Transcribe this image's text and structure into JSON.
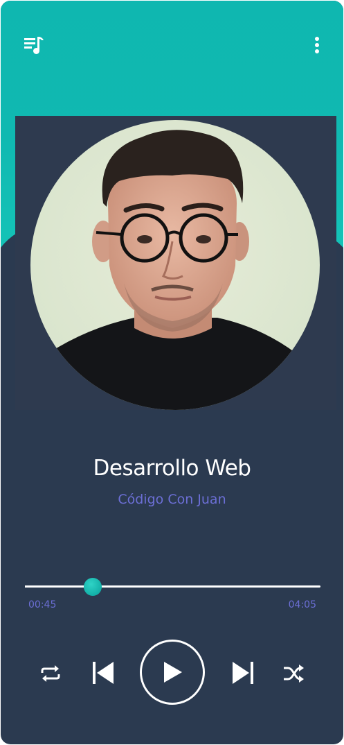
{
  "song": {
    "title": "Desarrollo Web",
    "artist": "Código Con Juan"
  },
  "progress": {
    "current_time": "00:45",
    "total_time": "04:05",
    "fraction": 0.23
  },
  "icons": {
    "playlist": "playlist-icon",
    "more": "more-vertical-icon",
    "repeat": "repeat-icon",
    "previous": "skip-previous-icon",
    "play": "play-icon",
    "next": "skip-next-icon",
    "shuffle": "shuffle-icon"
  },
  "colors": {
    "header": "#0fb9b1",
    "background": "#2b3a50",
    "accent_text": "#6c6fd6",
    "thumb": "#13b0a8"
  }
}
